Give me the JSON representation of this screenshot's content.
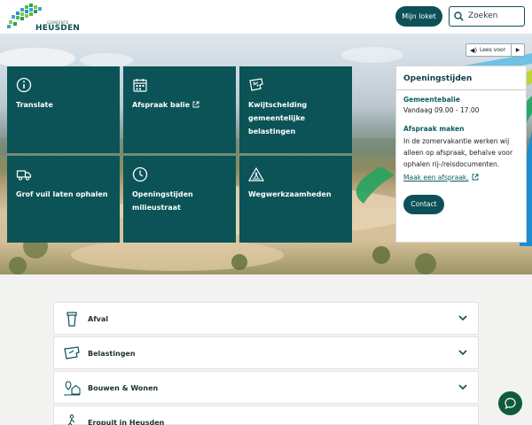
{
  "header": {
    "logo": {
      "gemeente": "GEMEENTE",
      "name": "HEUSDEN"
    },
    "loket_label": "Mijn loket",
    "search_label": "Zoeken"
  },
  "hero": {
    "lees_voor": "Lees voor"
  },
  "tiles": [
    {
      "label": "Translate",
      "icon": "info-icon",
      "external": false
    },
    {
      "label": "Afspraak balie",
      "icon": "calendar-icon",
      "external": true
    },
    {
      "label": "Kwijtschelding gemeentelijke belastingen",
      "icon": "tax-ticket-icon",
      "external": false
    },
    {
      "label": "Grof vuil laten ophalen",
      "icon": "truck-icon",
      "external": false
    },
    {
      "label": "Openingstijden milieustraat",
      "icon": "clock-icon",
      "external": false
    },
    {
      "label": "Wegwerkzaamheden",
      "icon": "roadworks-icon",
      "external": false
    }
  ],
  "openingstijden": {
    "title": "Openingstijden",
    "gemeentebalie_heading": "Gemeentebalie",
    "gemeentebalie_hours": "Vandaag 09.00 - 17.00",
    "afspraak_heading": "Afspraak maken",
    "afspraak_text": "In de zomervakantie werken wij alleen op afspraak, behalve voor ophalen rij-/reisdocumenten.",
    "afspraak_link": "Maak een afspraak.",
    "contact_label": "Contact"
  },
  "accordion": [
    {
      "label": "Afval",
      "icon": "waste-bin-icon"
    },
    {
      "label": "Belastingen",
      "icon": "tax-ticket-icon"
    },
    {
      "label": "Bouwen & Wonen",
      "icon": "house-location-icon"
    },
    {
      "label": "Eropuit in Heusden",
      "icon": "hiker-icon"
    }
  ],
  "colors": {
    "primary": "#0d5158",
    "tile": "#0b5357",
    "accent_green": "#0f5a3e"
  }
}
